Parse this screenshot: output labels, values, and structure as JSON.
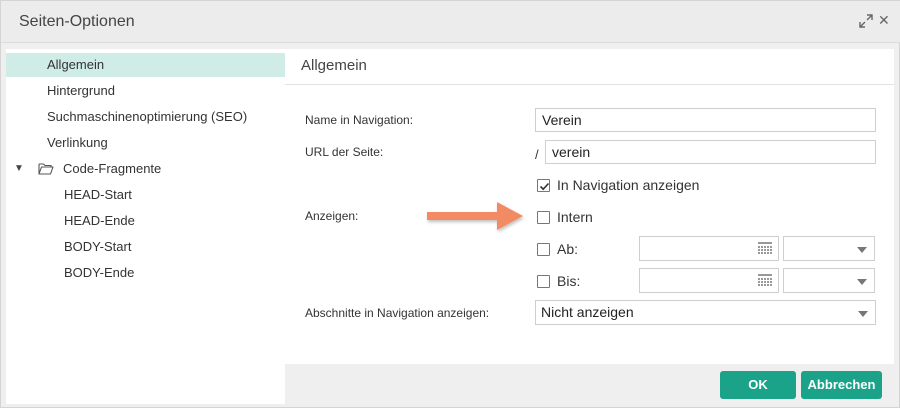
{
  "dialog": {
    "title": "Seiten-Optionen"
  },
  "sidebar": {
    "items": [
      {
        "label": "Allgemein",
        "selected": true
      },
      {
        "label": "Hintergrund"
      },
      {
        "label": "Suchmaschinenoptimierung (SEO)"
      },
      {
        "label": "Verlinkung"
      },
      {
        "label": "Code-Fragmente",
        "expanded": true,
        "icon": "folder-open-icon"
      },
      {
        "label": "HEAD-Start"
      },
      {
        "label": "HEAD-Ende"
      },
      {
        "label": "BODY-Start"
      },
      {
        "label": "BODY-Ende"
      }
    ]
  },
  "content": {
    "section_title": "Allgemein",
    "name_label": "Name in Navigation:",
    "name_value": "Verein",
    "url_label": "URL der Seite:",
    "url_prefix": "/",
    "url_value": "verein",
    "show_in_nav_label": "In Navigation anzeigen",
    "show_in_nav_checked": true,
    "anzeigen_label": "Anzeigen:",
    "intern_label": "Intern",
    "intern_checked": false,
    "ab_label": "Ab:",
    "ab_checked": false,
    "bis_label": "Bis:",
    "bis_checked": false,
    "sections_label": "Abschnitte in Navigation anzeigen:",
    "sections_value": "Nicht anzeigen"
  },
  "footer": {
    "ok_label": "OK",
    "cancel_label": "Abbrechen"
  },
  "colors": {
    "accent": "#1ba38a",
    "selected_bg": "#cfece6",
    "arrow": "#f28a64"
  }
}
